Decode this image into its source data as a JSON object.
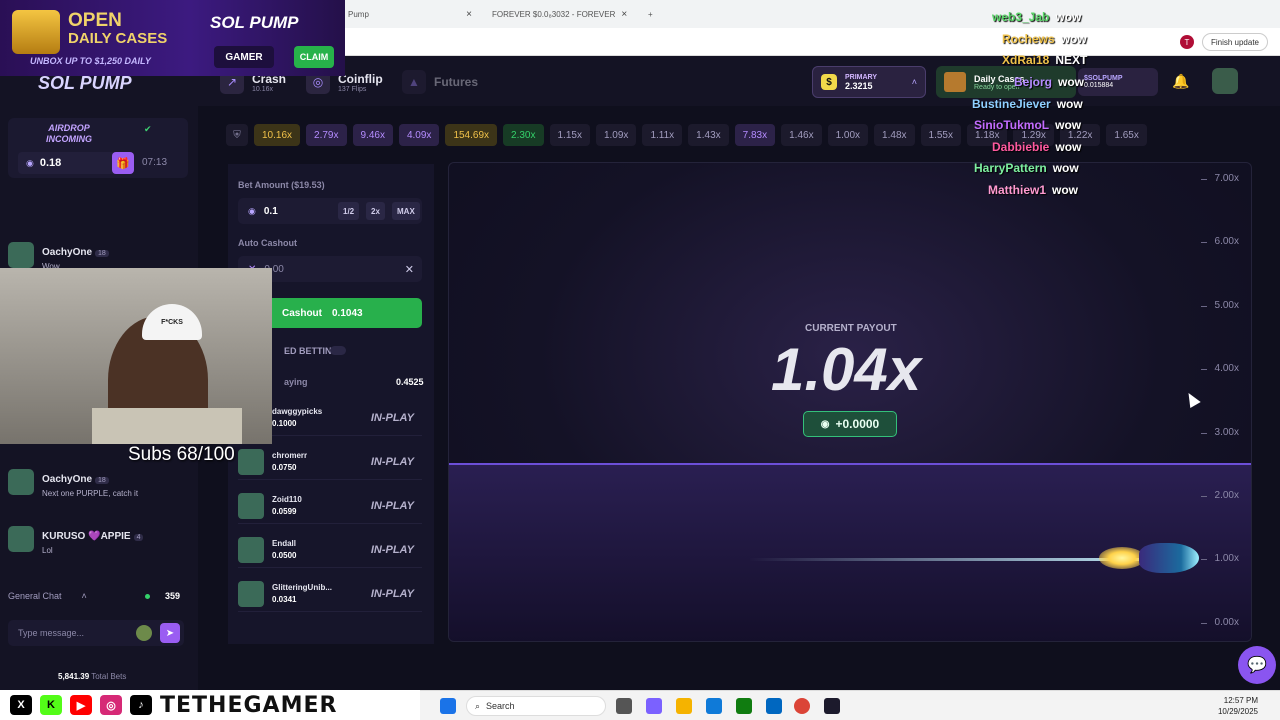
{
  "browser": {
    "tab1": "Pump",
    "tab2": "FOREVER $0.0₈3032 - FOREVER",
    "finish_update": "Finish update",
    "profile_initial": "T"
  },
  "banner": {
    "open": "OPEN",
    "daily_cases": "DAILY CASES",
    "unbox": "UNBOX UP TO $1,250 DAILY",
    "brand": "SOL PUMP",
    "gamer": "GAMER",
    "claim": "CLAIM"
  },
  "header": {
    "logo": "SOL PUMP",
    "tabs": [
      {
        "name": "Crash",
        "sub": "10.16x"
      },
      {
        "name": "Coinflip",
        "sub": "137 Flips"
      },
      {
        "name": "Futures",
        "sub": ""
      }
    ],
    "wallet": {
      "label": "PRIMARY",
      "value": "2.3215"
    },
    "daily_case": {
      "title": "Daily Cases",
      "sub": "Ready to open"
    },
    "solpump": {
      "label": "$SOLPUMP",
      "value": "0.015884"
    }
  },
  "history": [
    "10.16x",
    "2.79x",
    "9.46x",
    "4.09x",
    "154.69x",
    "2.30x",
    "1.15x",
    "1.09x",
    "1.11x",
    "1.43x",
    "7.83x",
    "1.46x",
    "1.00x",
    "1.48x",
    "1.55x",
    "1.18x",
    "1.29x",
    "1.22x",
    "1.65x"
  ],
  "chat": {
    "airdrop_title": "AIRDROP",
    "airdrop_sub": "INCOMING",
    "airdrop_amount": "0.18",
    "airdrop_timer": "07:13",
    "messages": [
      {
        "user": "OachyOne",
        "level": "18",
        "text": "Wow"
      },
      {
        "user": "OachyOne",
        "level": "18",
        "text": "Next one PURPLE, catch it"
      },
      {
        "user": "KURUSO 💜APPIE",
        "level": "4",
        "text": "Lol"
      }
    ],
    "channel": "General Chat",
    "online": "359",
    "placeholder": "Type message...",
    "total_bets_value": "5,841.39",
    "total_bets_label": "Total Bets"
  },
  "bet": {
    "amount_label": "Bet Amount ($19.53)",
    "amount": "0.1",
    "half": "1/2",
    "double": "2x",
    "max": "MAX",
    "auto_label": "Auto Cashout",
    "auto_value": "0.00",
    "cashout_label": "Cashout",
    "cashout_value": "0.1043",
    "advanced": "ED BETTING",
    "playing": "aying",
    "pool": "0.4525",
    "players": [
      {
        "name": "dawggypicks",
        "value": "0.1000",
        "status": "IN-PLAY"
      },
      {
        "name": "chromerr",
        "value": "0.0750",
        "status": "IN-PLAY"
      },
      {
        "name": "Zoid110",
        "value": "0.0599",
        "status": "IN-PLAY"
      },
      {
        "name": "Endall",
        "value": "0.0500",
        "status": "IN-PLAY"
      },
      {
        "name": "GlitteringUnib...",
        "value": "0.0341",
        "status": "IN-PLAY"
      }
    ]
  },
  "game": {
    "payout_label": "CURRENT PAYOUT",
    "payout": "1.04x",
    "profit": "+0.0000",
    "axis": [
      "7.00x",
      "6.00x",
      "5.00x",
      "4.00x",
      "3.00x",
      "2.00x",
      "1.00x",
      "0.00x"
    ]
  },
  "stream": {
    "subs": "Subs 68/100",
    "chat": [
      {
        "user": "web3_Jab",
        "text": "wow",
        "color": "#5bd66a"
      },
      {
        "user": "XdRai18",
        "text": "NEXT",
        "color": "#f0c24a"
      },
      {
        "user": "Rochews",
        "text": "wow",
        "color": "#f0c24a"
      },
      {
        "user": "Bejorg",
        "text": "wow",
        "color": "#b58cff"
      },
      {
        "user": "BustineJiever",
        "text": "wow",
        "color": "#8fd0ff"
      },
      {
        "user": "SinioTukmoL",
        "text": "wow",
        "color": "#c36cff"
      },
      {
        "user": "Dabbiebie",
        "text": "wow",
        "color": "#ff5aa0"
      },
      {
        "user": "HarryPattern",
        "text": "wow",
        "color": "#7ef0a0"
      },
      {
        "user": "Matthiew1",
        "text": "wow",
        "color": "#ff9ad0"
      }
    ]
  },
  "brand_bar": {
    "handle": "TETHEGAMER"
  },
  "taskbar": {
    "search": "Search",
    "time": "12:57 PM",
    "date": "10/29/2025"
  }
}
